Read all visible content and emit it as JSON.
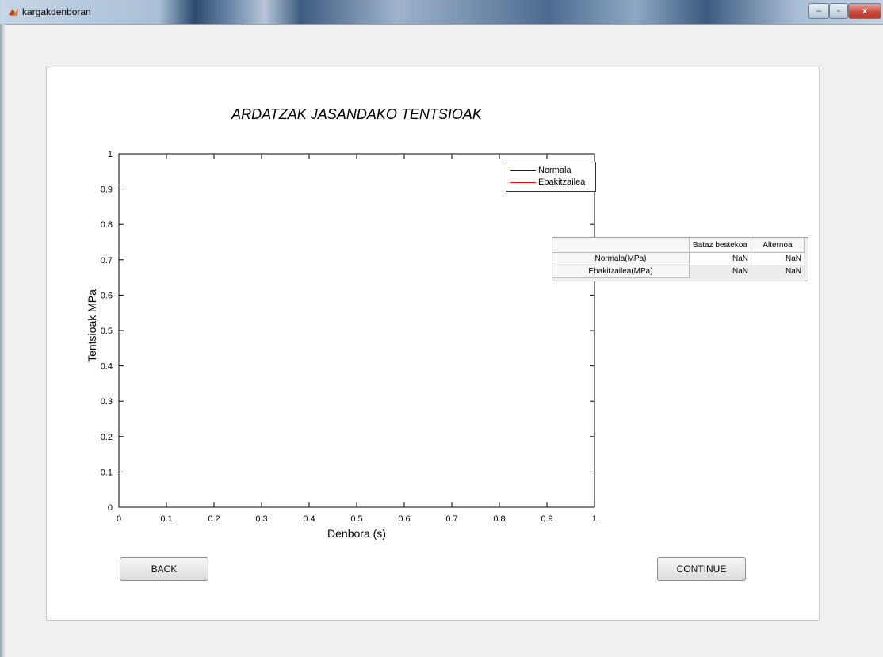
{
  "window": {
    "title": "kargakdenboran",
    "controls": {
      "minimize": "–",
      "maximize": "▫",
      "close": "x"
    }
  },
  "plot": {
    "title": "ARDATZAK JASANDAKO TENTSIOAK",
    "legend": [
      {
        "label": "Normala",
        "color": "#0000ff"
      },
      {
        "label": "Ebakitzailea",
        "color": "#ff0000"
      }
    ]
  },
  "chart_data": {
    "type": "line",
    "title": "ARDATZAK JASANDAKO TENTSIOAK",
    "xlabel": "Denbora (s)",
    "ylabel": "Tentsioak MPa",
    "xlim": [
      0,
      1
    ],
    "ylim": [
      0,
      1
    ],
    "xticks": [
      "0",
      "0.1",
      "0.2",
      "0.3",
      "0.4",
      "0.5",
      "0.6",
      "0.7",
      "0.8",
      "0.9",
      "1"
    ],
    "yticks": [
      "0",
      "0.1",
      "0.2",
      "0.3",
      "0.4",
      "0.5",
      "0.6",
      "0.7",
      "0.8",
      "0.9",
      "1"
    ],
    "series": [
      {
        "name": "Normala",
        "color": "#0000ff",
        "x": [],
        "y": []
      },
      {
        "name": "Ebakitzailea",
        "color": "#ff0000",
        "x": [],
        "y": []
      }
    ],
    "legend_position": "top-right",
    "grid": false
  },
  "table": {
    "columns": [
      "Bataz bestekoa",
      "Alternoa"
    ],
    "rows": [
      {
        "label": "Normala(MPa)",
        "values": [
          "NaN",
          "NaN"
        ]
      },
      {
        "label": "Ebakitzailea(MPa)",
        "values": [
          "NaN",
          "NaN"
        ]
      }
    ]
  },
  "buttons": {
    "back": "BACK",
    "continue": "CONTINUE"
  }
}
